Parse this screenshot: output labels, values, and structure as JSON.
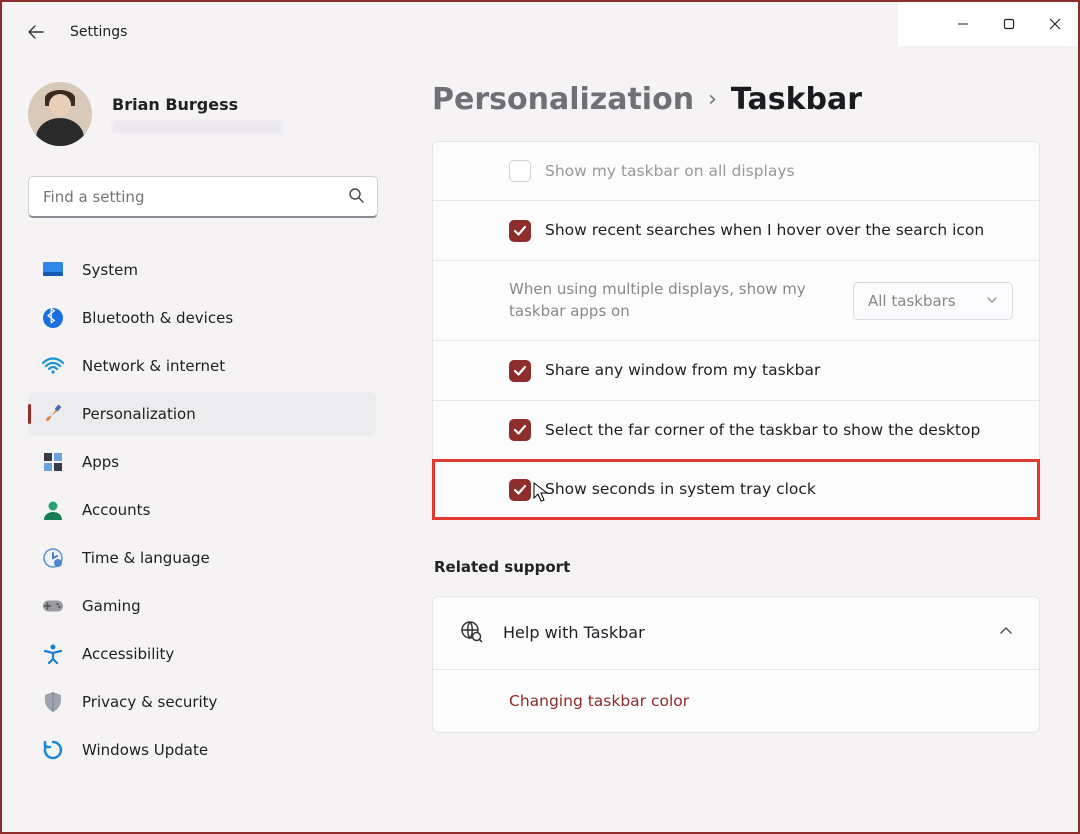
{
  "app": {
    "title": "Settings"
  },
  "profile": {
    "name": "Brian Burgess"
  },
  "search": {
    "placeholder": "Find a setting"
  },
  "nav": {
    "items": [
      {
        "label": "System",
        "icon": "system"
      },
      {
        "label": "Bluetooth & devices",
        "icon": "bluetooth"
      },
      {
        "label": "Network & internet",
        "icon": "wifi"
      },
      {
        "label": "Personalization",
        "icon": "brush",
        "selected": true
      },
      {
        "label": "Apps",
        "icon": "apps"
      },
      {
        "label": "Accounts",
        "icon": "account"
      },
      {
        "label": "Time & language",
        "icon": "clock"
      },
      {
        "label": "Gaming",
        "icon": "gaming"
      },
      {
        "label": "Accessibility",
        "icon": "accessibility"
      },
      {
        "label": "Privacy & security",
        "icon": "shield"
      },
      {
        "label": "Windows Update",
        "icon": "update"
      }
    ]
  },
  "breadcrumb": {
    "level1": "Personalization",
    "level2": "Taskbar"
  },
  "settings": [
    {
      "id": "show-all-displays",
      "label": "Show my taskbar on all displays",
      "checked": false,
      "disabled": true
    },
    {
      "id": "recent-searches",
      "label": "Show recent searches when I hover over the search icon",
      "checked": true
    },
    {
      "id": "multi-displays",
      "sublabel": "When using multiple displays, show my taskbar apps on",
      "select_value": "All taskbars",
      "is_select": true,
      "disabled": true
    },
    {
      "id": "share-window",
      "label": "Share any window from my taskbar",
      "checked": true
    },
    {
      "id": "far-corner",
      "label": "Select the far corner of the taskbar to show the desktop",
      "checked": true
    },
    {
      "id": "show-seconds",
      "label": "Show seconds in system tray clock",
      "checked": true,
      "highlight": true,
      "cursor": true
    }
  ],
  "related": {
    "title": "Related support",
    "help_title": "Help with Taskbar",
    "link": "Changing taskbar color"
  }
}
